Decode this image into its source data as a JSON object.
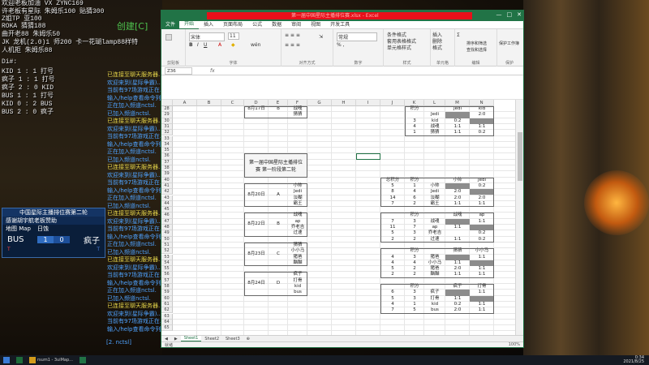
{
  "overlay": {
    "hud_lines": [
      "欢迎老板加油 VX ZYNC169",
      "许老板有星际 朱姆乐100 贴猜300",
      "Z姐TP       亚100",
      "ROKA 猜猜188",
      "曲开老88 朱姆乐50",
      "JK 龙机(2.0)1 师200 卡一花瑚lamp88样特",
      "人机拒 朱姆乐88",
      "Di#:",
      "KID 1 : 1 打号",
      "疯子 1 : 1 打号",
      "疯子 2 : 0 KID",
      "BUS 1 : 1 打号",
      "KID 0 : 2 BUS",
      "BUS 2 : 0 疯子"
    ],
    "create_label": "创建[C]",
    "chat": [
      "已连接至聊天服务器...",
      "欢迎来到(星际争霸)...",
      "当前有97场游戏正在...",
      "输入/help查看命令列表",
      "正在加入频道nctsl.",
      "已加入频道nctsl.",
      "已连接至聊天服务器...",
      "欢迎来到(星际争霸)...",
      "当前有97场游戏正在...",
      "输入/help查看命令列表",
      "正在加入频道nctsl.",
      "已加入频道nctsl.",
      "已连接至聊天服务器...",
      "欢迎来到(星际争霸)...",
      "当前有97场游戏正在...",
      "输入/help查看命令列表",
      "正在加入频道nctsl.",
      "已加入频道nctsl.",
      "已连接至聊天服务器...",
      "欢迎来到(星际争霸)...",
      "当前有97场游戏正在...",
      "输入/help查看命令列表",
      "正在加入频道nctsl.",
      "已加入频道nctsl.",
      "已连接至聊天服务器...",
      "欢迎来到(星际争霸)...",
      "当前有97场游戏正在...",
      "输入/help查看命令列表",
      "正在加入频道nctsl.",
      "已加入频道nctsl.",
      "已连接至聊天服务器...",
      "欢迎来到(星际争霸)...",
      "当前有97场游戏正在...",
      "输入/help查看命令列表"
    ],
    "chat_footer": "[2. nctsl]"
  },
  "scoreboard": {
    "title": "中国星际主播排位赛第二轮",
    "sponsor": "感谢胡宇航老板赞助",
    "map_label": "地图 Map",
    "map_name": "日蚀",
    "left_player": "BUS",
    "left_score": "1",
    "right_score": "0",
    "right_player": "疯子",
    "left_race": "T",
    "right_race": "T"
  },
  "excel": {
    "title": "第一届中国星际主播排位赛.xlsx - Excel",
    "win_min": "—",
    "win_max": "□",
    "win_close": "✕",
    "file_tab": "文件",
    "tabs": [
      "开始",
      "插入",
      "页面布局",
      "公式",
      "数据",
      "审阅",
      "视图",
      "开发工具"
    ],
    "active_tab": "开始",
    "name_box": "Z36",
    "fx": "fx",
    "sheets": [
      "Sheet1",
      "Sheet2",
      "Sheet3"
    ],
    "add_sheet": "⊕",
    "status_ready": "就绪",
    "zoom": "100%"
  },
  "ribbon": {
    "clipboard": "剪贴板",
    "font": "字体",
    "alignment": "对齐方式",
    "number": "数字",
    "styles": "样式",
    "cells": "单元格",
    "editing": "编辑",
    "protect_group": "保护",
    "font_name": "宋体",
    "font_size": "11",
    "bold": "B",
    "italic": "I",
    "underline": "U",
    "font_color_glyph": "A",
    "fill_glyph": "◆",
    "phonetic_glyph": "wén",
    "align_glyph": "≡ ≡ ≡",
    "align_glyph2": "≡ ≡ ≡",
    "wrap_glyph": "⇲",
    "number_format": "常规",
    "number_glyphs": "% ,",
    "cond_format": "条件格式",
    "table_format": "套用表格格式",
    "cell_style": "单元格样式",
    "insert": "插入",
    "delete": "删除",
    "format": "格式",
    "sum_glyph": "Σ",
    "sort_filter": "排序和筛选",
    "find_select": "查找和选择",
    "protect": "保护工作簿"
  },
  "grid": {
    "columns": [
      "A",
      "B",
      "C",
      "D",
      "E",
      "F",
      "G",
      "H",
      "I",
      "J",
      "K",
      "L",
      "M",
      "N"
    ],
    "rows": [
      "28",
      "29",
      "30",
      "31",
      "32",
      "33",
      "34",
      "35",
      "36",
      "37",
      "38",
      "39",
      "40",
      "41",
      "42",
      "43",
      "44",
      "45",
      "46",
      "47",
      "48",
      "49",
      "50",
      "51",
      "52",
      "53",
      "54",
      "55",
      "56",
      "57",
      "58",
      "59",
      "60",
      "61",
      "62",
      "63",
      "64",
      "65"
    ],
    "left_top_cells": [
      {
        "row": 0,
        "col": "D",
        "text": "8月17日"
      },
      {
        "row": 0,
        "col": "E",
        "text": "B"
      },
      {
        "row": 0,
        "col": "F",
        "text": "战魂"
      },
      {
        "row": 1,
        "col": "F",
        "text": "猜猜"
      }
    ],
    "left_header_title": "第一届中国星际主播排位赛 第一阶段第二轮",
    "left_blocks": [
      {
        "date": "8月20日",
        "group": "A",
        "players": [
          "小帅",
          "Jedi",
          "淡糊",
          "霸王"
        ]
      },
      {
        "date": "8月22日",
        "group": "B",
        "players": [
          "战魂",
          "ap",
          "乔老吉",
          "过速"
        ]
      },
      {
        "date": "8月23日",
        "group": "C",
        "players": [
          "猜猜",
          "小小马",
          "猪爸",
          "酗酗"
        ]
      },
      {
        "date": "8月24日",
        "group": "D",
        "players": [
          "疯子",
          "打骨",
          "kid",
          "bus"
        ]
      }
    ],
    "right_top": {
      "header": [
        "积分",
        "",
        "Jedi",
        "kid"
      ],
      "rows": [
        [
          "",
          "",
          "Jedi",
          "",
          "2:0"
        ],
        [
          "",
          "3",
          "kid",
          "0:2",
          ""
        ],
        [
          "",
          "4",
          "战魂",
          "1:1",
          "1:1"
        ],
        [
          "",
          "1",
          "猜猜",
          "1:1",
          "0:2"
        ]
      ]
    },
    "right_blocks": [
      {
        "header": [
          "总积分",
          "积分",
          "",
          "小帅",
          "Jedi"
        ],
        "rows": [
          [
            "5",
            "1",
            "小帅",
            "",
            "0:2"
          ],
          [
            "8",
            "4",
            "Jedi",
            "2:0",
            ""
          ],
          [
            "14",
            "6",
            "淡糊",
            "2:0",
            "2:0"
          ],
          [
            "7",
            "2",
            "霸王",
            "1:1",
            "1:1"
          ]
        ]
      },
      {
        "header": [
          "",
          "积分",
          "",
          "战魂",
          "ap"
        ],
        "rows": [
          [
            "7",
            "3",
            "战魂",
            "",
            "1:1"
          ],
          [
            "11",
            "7",
            "ap",
            "1:1",
            ""
          ],
          [
            "5",
            "3",
            "乔老吉",
            "",
            "0:2"
          ],
          [
            "2",
            "2",
            "过速",
            "1:1",
            "0:2"
          ]
        ]
      },
      {
        "header": [
          "",
          "积分",
          "",
          "猜猜",
          "小小马"
        ],
        "rows": [
          [
            "4",
            "3",
            "猪爸",
            "",
            "1:1"
          ],
          [
            "4",
            "4",
            "小小马",
            "1:1",
            ""
          ],
          [
            "5",
            "2",
            "猪爸",
            "2:0",
            "1:1"
          ],
          [
            "2",
            "2",
            "酗酗",
            "1:1",
            "1:1"
          ]
        ]
      },
      {
        "header": [
          "",
          "积分",
          "",
          "疯子",
          "打骨"
        ],
        "rows": [
          [
            "6",
            "3",
            "疯子",
            "",
            "1:1"
          ],
          [
            "5",
            "3",
            "打骨",
            "1:1",
            ""
          ],
          [
            "4",
            "1",
            "kid",
            "0:2",
            "1:1"
          ],
          [
            "7",
            "5",
            "bus",
            "2:0",
            "1:1"
          ]
        ]
      }
    ]
  },
  "taskbar": {
    "app_label": "rsum1 - 3uiMap...",
    "time": "0:34",
    "date": "2021/8/25"
  }
}
